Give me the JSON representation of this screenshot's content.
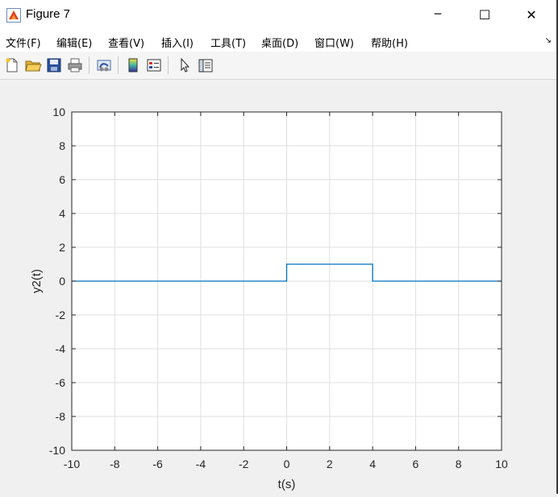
{
  "window": {
    "title": "Figure 7",
    "minimize_glyph": "─",
    "maximize_glyph": "☐",
    "close_glyph": "✕"
  },
  "menu": {
    "items": [
      {
        "label": "文件(F)"
      },
      {
        "label": "编辑(E)"
      },
      {
        "label": "查看(V)"
      },
      {
        "label": "插入(I)"
      },
      {
        "label": "工具(T)"
      },
      {
        "label": "桌面(D)"
      },
      {
        "label": "窗口(W)"
      },
      {
        "label": "帮助(H)"
      }
    ],
    "overflow_glyph": "↘"
  },
  "toolbar": {
    "buttons": [
      {
        "icon": "new-file-icon"
      },
      {
        "icon": "open-folder-icon"
      },
      {
        "icon": "save-icon"
      },
      {
        "icon": "print-icon"
      },
      {
        "icon": "link-icon"
      },
      {
        "icon": "colorbar-icon"
      },
      {
        "icon": "legend-icon"
      },
      {
        "icon": "pointer-icon"
      },
      {
        "icon": "property-editor-icon"
      }
    ]
  },
  "colors": {
    "line": "#0072bd",
    "axes_bg": "#ffffff",
    "grid": "#dfdfdf",
    "app_icon": "#e0401c"
  },
  "chart_data": {
    "type": "line",
    "xlabel": "t(s)",
    "ylabel": "y2(t)",
    "xlim": [
      -10,
      10
    ],
    "ylim": [
      -10,
      10
    ],
    "xticks": [
      -10,
      -8,
      -6,
      -4,
      -2,
      0,
      2,
      4,
      6,
      8,
      10
    ],
    "yticks": [
      -10,
      -8,
      -6,
      -4,
      -2,
      0,
      2,
      4,
      6,
      8,
      10
    ],
    "grid": true,
    "series": [
      {
        "x": [
          -10,
          0,
          0,
          4,
          4,
          10
        ],
        "y": [
          0,
          0,
          1,
          1,
          0,
          0
        ]
      }
    ]
  }
}
